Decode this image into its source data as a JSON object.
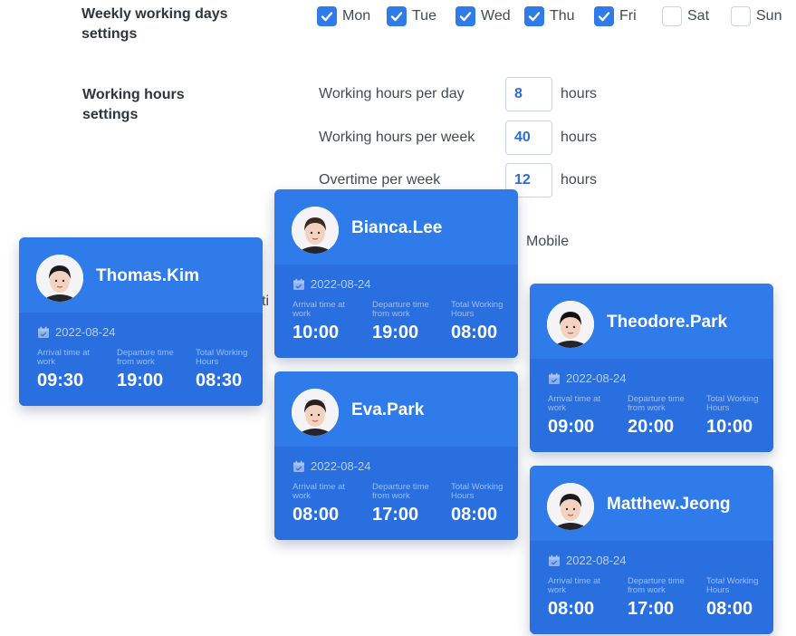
{
  "weekly": {
    "label_line1": "Weekly working days",
    "label_line2": "settings",
    "days": [
      {
        "label": "Mon",
        "checked": true
      },
      {
        "label": "Tue",
        "checked": true
      },
      {
        "label": "Wed",
        "checked": true
      },
      {
        "label": "Thu",
        "checked": true
      },
      {
        "label": "Fri",
        "checked": true
      },
      {
        "label": "Sat",
        "checked": false
      },
      {
        "label": "Sun",
        "checked": false
      }
    ]
  },
  "hours": {
    "label_line1": "Working hours",
    "label_line2": "settings",
    "rows": [
      {
        "label": "Working hours per day",
        "value": "8",
        "unit": "hours"
      },
      {
        "label": "Working hours per week",
        "value": "40",
        "unit": "hours"
      },
      {
        "label": "Overtime per week",
        "value": "12",
        "unit": "hours"
      }
    ]
  },
  "stray": {
    "mobile": "Mobile",
    "fragment": "ti"
  },
  "card_labels": {
    "arrival": "Arrival time at work",
    "departure": "Departure time from work",
    "total": "Total Working Hours"
  },
  "cards": [
    {
      "name": "Thomas.Kim",
      "date": "2022-08-24",
      "arrival": "09:30",
      "departure": "19:00",
      "total": "08:30",
      "avatar_hair": "#1b1b1f"
    },
    {
      "name": "Bianca.Lee",
      "date": "2022-08-24",
      "arrival": "10:00",
      "departure": "19:00",
      "total": "08:00",
      "avatar_hair": "#3a2a20"
    },
    {
      "name": "Eva.Park",
      "date": "2022-08-24",
      "arrival": "08:00",
      "departure": "17:00",
      "total": "08:00",
      "avatar_hair": "#2a1f1a"
    },
    {
      "name": "Theodore.Park",
      "date": "2022-08-24",
      "arrival": "09:00",
      "departure": "20:00",
      "total": "10:00",
      "avatar_hair": "#111114"
    },
    {
      "name": "Matthew.Jeong",
      "date": "2022-08-24",
      "arrival": "08:00",
      "departure": "17:00",
      "total": "08:00",
      "avatar_hair": "#1a1a1e"
    }
  ],
  "colors": {
    "accent": "#2f7bea",
    "card_bottom": "#2a6fe0",
    "input_text": "#2f6bd6"
  }
}
